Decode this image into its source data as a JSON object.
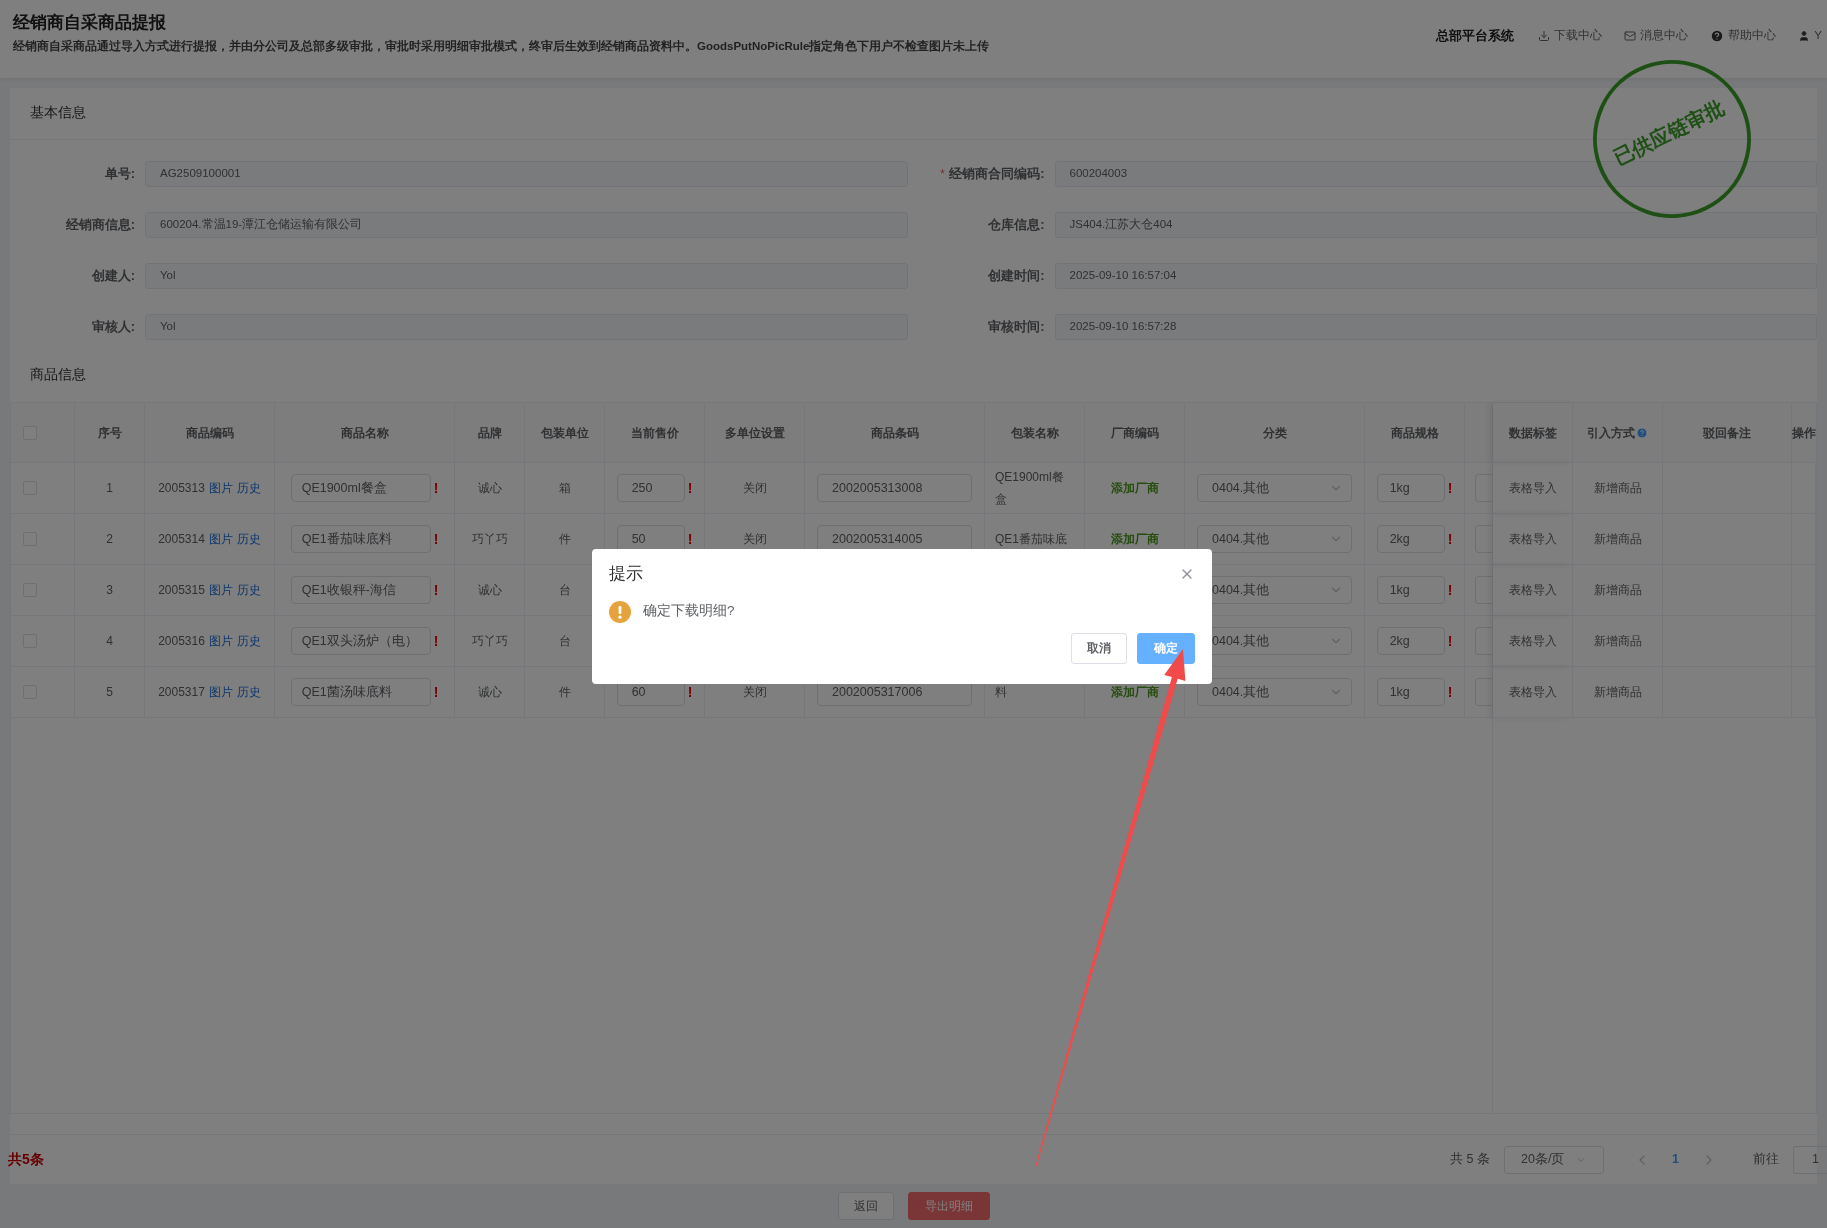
{
  "header": {
    "title": "经销商自采商品提报",
    "subtitle": "经销商自采商品通过导入方式进行提报，并由分公司及总部多级审批，审批时采用明细审批模式，终审后生效到经销商品资料中。GoodsPutNoPicRule指定角色下用户不检查图片未上传",
    "system_name": "总部平台系统",
    "links": [
      {
        "kind": "download",
        "label": "下载中心"
      },
      {
        "kind": "message",
        "label": "消息中心"
      },
      {
        "kind": "help",
        "label": "帮助中心"
      },
      {
        "kind": "user",
        "label": "Y"
      }
    ]
  },
  "basic_info": {
    "title": "基本信息",
    "fields": [
      {
        "label": "单号:",
        "value": "AG2509100001"
      },
      {
        "label": "经销商合同编码:",
        "value": "600204003",
        "marker": "*"
      },
      {
        "label": "经销商信息:",
        "value": "600204.常温19-潭江仓储运输有限公司"
      },
      {
        "label": "仓库信息:",
        "value": "JS404.江苏大仓404"
      },
      {
        "label": "创建人:",
        "value": "Yol"
      },
      {
        "label": "创建时间:",
        "value": "2025-09-10 16:57:04"
      },
      {
        "label": "审核人:",
        "value": "Yol"
      },
      {
        "label": "审核时间:",
        "value": "2025-09-10 16:57:28"
      }
    ]
  },
  "stamp": {
    "text": "已供应链审批"
  },
  "goods": {
    "title": "商品信息",
    "select_all": {
      "checked": false
    },
    "columns": [
      "序号",
      "商品编码",
      "商品名称",
      "品牌",
      "包装单位",
      "当前售价",
      "多单位设置",
      "商品条码",
      "包装名称",
      "厂商编码",
      "分类",
      "商品规格",
      "数据标签",
      "引入方式",
      "驳回备注",
      "操作"
    ],
    "rows": [
      {
        "checked": false,
        "no": "1",
        "code": "2005313",
        "links": [
          "图片",
          "历史"
        ],
        "name": "QE1900ml餐盒",
        "name_flag": "!",
        "brand": "诚心",
        "unit": "箱",
        "price": "250",
        "price_flag": "!",
        "multi_unit": "关闭",
        "barcode": "2002005313008",
        "pack_name": "QE1900ml餐盒",
        "vendor": "添加厂商",
        "category": "0404.其他",
        "spec": "1kg",
        "spec_flag": "!",
        "data_tag": "表格导入",
        "import_method": "新增商品"
      },
      {
        "checked": false,
        "no": "2",
        "code": "2005314",
        "links": [
          "图片",
          "历史"
        ],
        "name": "QE1番茄味底料",
        "name_flag": "!",
        "brand": "巧丫巧",
        "unit": "件",
        "price": "50",
        "price_flag": "!",
        "multi_unit": "关闭",
        "barcode": "2002005314005",
        "pack_name": "QE1番茄味底",
        "vendor": "添加厂商",
        "category": "0404.其他",
        "spec": "2kg",
        "spec_flag": "!",
        "data_tag": "表格导入",
        "import_method": "新增商品"
      },
      {
        "checked": false,
        "no": "3",
        "code": "2005315",
        "links": [
          "图片",
          "历史"
        ],
        "name": "QE1收银秤-海信",
        "name_flag": "!",
        "brand": "诚心",
        "unit": "台",
        "category": "0404.其他",
        "spec": "1kg",
        "spec_flag": "!",
        "data_tag": "表格导入",
        "import_method": "新增商品"
      },
      {
        "checked": false,
        "no": "4",
        "code": "2005316",
        "links": [
          "图片",
          "历史"
        ],
        "name": "QE1双头汤炉（电）",
        "name_flag": "!",
        "brand": "巧丫巧",
        "unit": "台",
        "category": "0404.其他",
        "spec": "2kg",
        "spec_flag": "!",
        "data_tag": "表格导入",
        "import_method": "新增商品"
      },
      {
        "checked": false,
        "no": "5",
        "code": "2005317",
        "links": [
          "图片",
          "历史"
        ],
        "name": "QE1菌汤味底料",
        "name_flag": "!",
        "brand": "诚心",
        "unit": "件",
        "price": "60",
        "price_flag": "!",
        "multi_unit": "关闭",
        "barcode": "2002005317006",
        "pack_name": "料",
        "vendor": "添加厂商",
        "category": "0404.其他",
        "spec": "1kg",
        "spec_flag": "!",
        "data_tag": "表格导入",
        "import_method": "新增商品"
      }
    ]
  },
  "summary": "共5条",
  "pagination": {
    "total": "共 5 条",
    "page_size": "20条/页",
    "pages": [
      {
        "label": "1",
        "selected": true
      }
    ],
    "goto_label": "前往",
    "goto_value": "1"
  },
  "actions": [
    {
      "kind": "default",
      "label": "返回"
    },
    {
      "kind": "danger",
      "label": "导出明细"
    }
  ],
  "dialog": {
    "title": "提示",
    "message": "确定下载明细?",
    "buttons": [
      {
        "kind": "default",
        "label": "取消"
      },
      {
        "kind": "primary",
        "label": "确定"
      }
    ]
  },
  "annotation": {
    "kind": "arrow"
  }
}
